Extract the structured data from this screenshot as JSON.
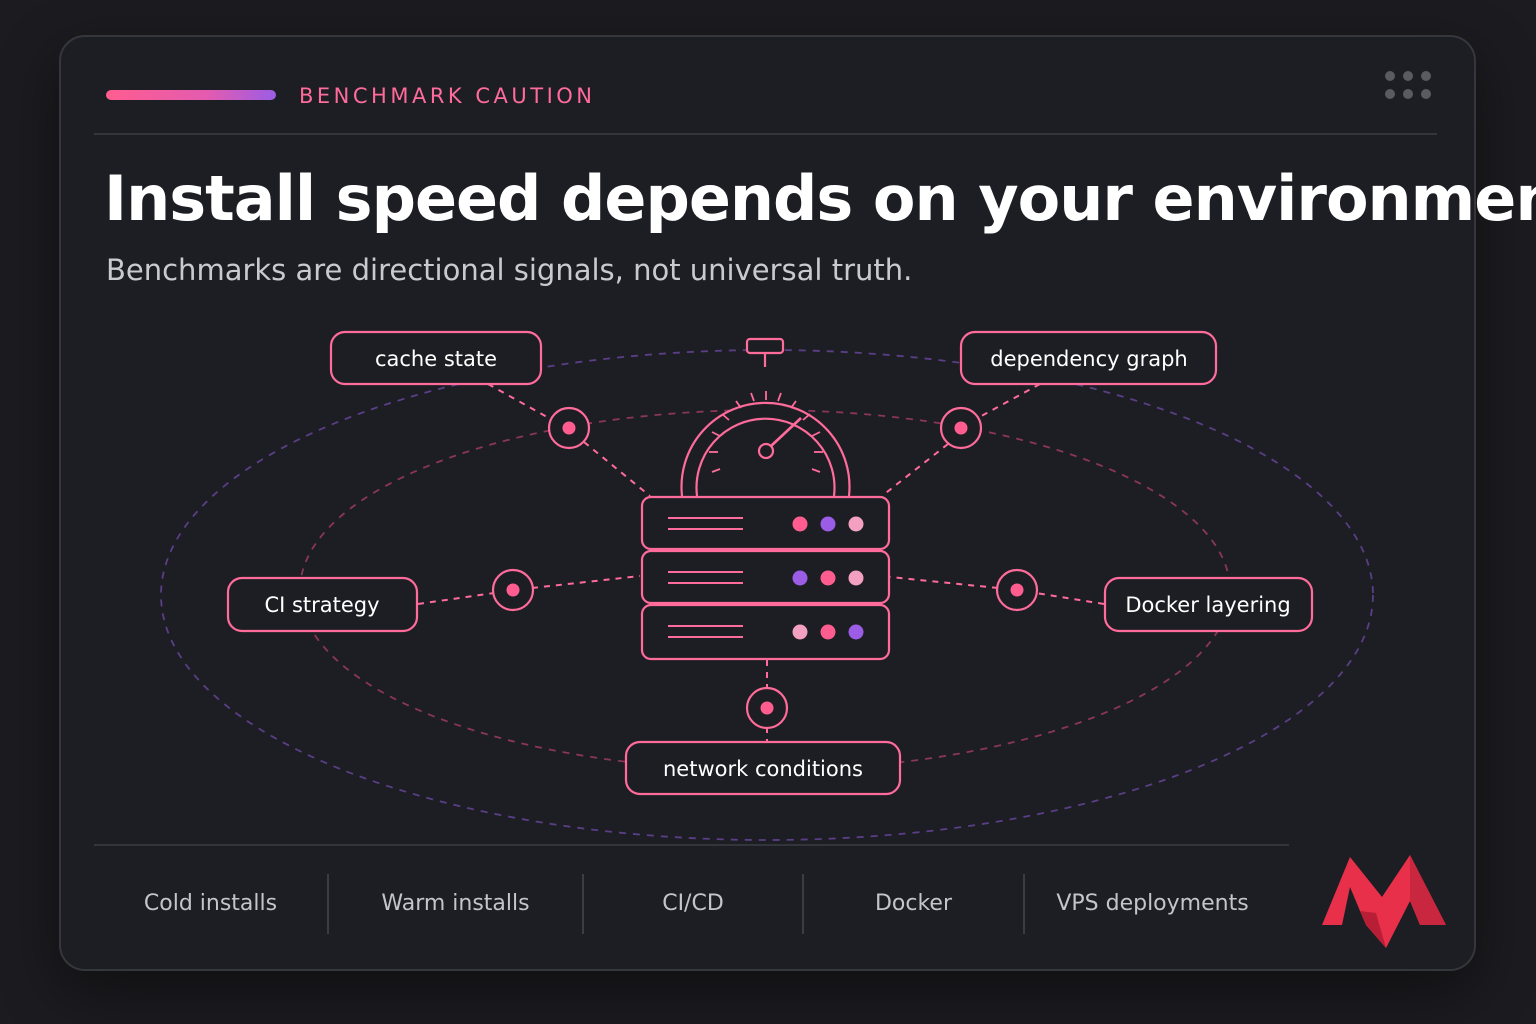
{
  "header": {
    "eyebrow": "BENCHMARK CAUTION",
    "title": "Install speed depends on your environment",
    "subtitle": "Benchmarks are directional signals, not universal truth."
  },
  "diagram": {
    "factors": [
      "cache state",
      "dependency graph",
      "CI strategy",
      "Docker layering",
      "network conditions"
    ]
  },
  "footer": {
    "items": [
      "Cold installs",
      "Warm installs",
      "CI/CD",
      "Docker",
      "VPS deployments"
    ]
  },
  "colors": {
    "accent_pink": "#ff5d8f",
    "accent_purple": "#9b5de5",
    "light_pink": "#f4a0c0",
    "logo_red": "#e8304a"
  },
  "icons": [
    "menu-dots-icon",
    "stopwatch-icon",
    "server-stack-icon",
    "brand-logo-icon"
  ]
}
